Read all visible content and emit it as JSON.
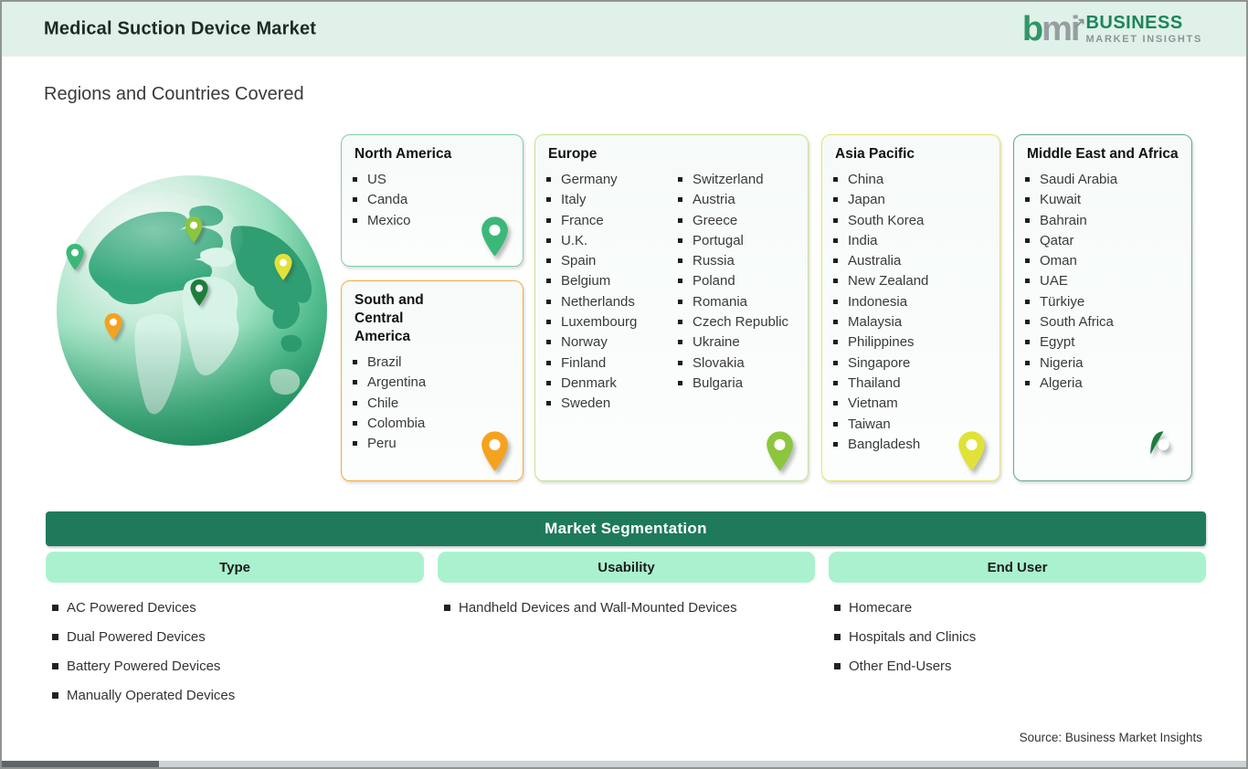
{
  "header": {
    "title": "Medical Suction Device Market",
    "logo": {
      "mark_b": "b",
      "mark_m": "m",
      "mark_i": "i",
      "arrow": "↗",
      "line1": "BUSINESS",
      "line2": "MARKET  INSIGHTS"
    }
  },
  "section_title": "Regions and Countries Covered",
  "regions": [
    {
      "title": "North America",
      "items": [
        "US",
        "Canda",
        "Mexico"
      ],
      "border_color": "#7fd0a6",
      "pin_color": "#3bb878"
    },
    {
      "title": "South and Central America",
      "items": [
        "Brazil",
        "Argentina",
        "Chile",
        "Colombia",
        "Peru"
      ],
      "border_color": "#f3ab3f",
      "pin_color": "#f5a21f"
    },
    {
      "title": "Europe",
      "items": [
        "Germany",
        "Italy",
        "France",
        "U.K.",
        "Spain",
        "Belgium",
        "Netherlands",
        "Luxembourg",
        "Norway",
        "Finland",
        "Denmark",
        "Sweden",
        "Switzerland",
        "Austria",
        "Greece",
        "Portugal",
        "Russia",
        "Poland",
        "Romania",
        "Czech Republic",
        "Ukraine",
        "Slovakia",
        "Bulgaria"
      ],
      "border_color": "#c6e294",
      "pin_color": "#8cc63e"
    },
    {
      "title": "Asia Pacific",
      "items": [
        "China",
        "Japan",
        "South Korea",
        "India",
        "Australia",
        "New Zealand",
        "Indonesia",
        "Malaysia",
        "Philippines",
        "Singapore",
        "Thailand",
        "Vietnam",
        "Taiwan",
        "Bangladesh"
      ],
      "border_color": "#e7e468",
      "pin_color": "#e0e23a"
    },
    {
      "title": "Middle East and Africa",
      "items": [
        "Saudi Arabia",
        "Kuwait",
        "Bahrain",
        "Qatar",
        "Oman",
        "UAE",
        "Türkiye",
        "South Africa",
        "Egypt",
        "Nigeria",
        "Algeria"
      ],
      "border_color": "#64aa8e",
      "pin_color": "#1e7d3d"
    }
  ],
  "globe_pins": [
    {
      "area": "north-america",
      "color": "#3bb878"
    },
    {
      "area": "europe",
      "color": "#8cc63e"
    },
    {
      "area": "asia",
      "color": "#e0e23a"
    },
    {
      "area": "middle-east",
      "color": "#1e7d3d"
    },
    {
      "area": "south-america",
      "color": "#f5a21f"
    }
  ],
  "segmentation": {
    "title": "Market Segmentation",
    "bar_color": "#1e7a5a",
    "pill_color": "#aaf2cf",
    "columns": [
      {
        "label": "Type",
        "items": [
          "AC Powered Devices",
          "Dual Powered Devices",
          "Battery Powered Devices",
          "Manually Operated Devices"
        ]
      },
      {
        "label": "Usability",
        "items": [
          "Handheld Devices and Wall-Mounted Devices"
        ]
      },
      {
        "label": "End User",
        "items": [
          "Homecare",
          "Hospitals and Clinics",
          "Other End-Users"
        ]
      }
    ]
  },
  "source": "Source: Business Market Insights",
  "colors": {
    "header_bg": "#dff1e8",
    "brand_green": "#1d8558",
    "brand_gray": "#8c9497"
  }
}
